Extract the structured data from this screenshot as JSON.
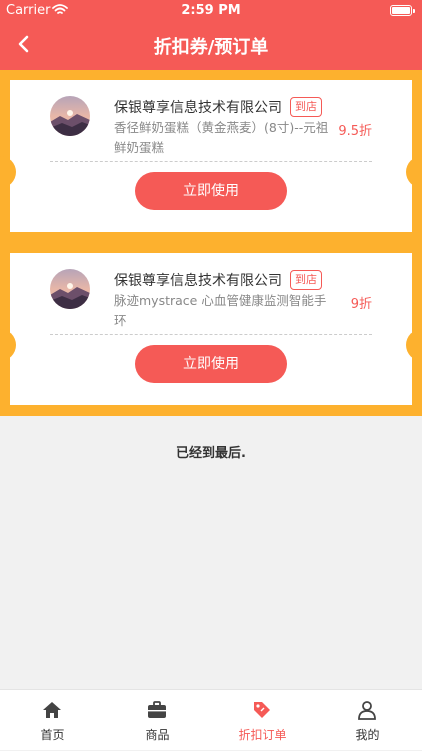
{
  "status_bar": {
    "carrier": "Carrier",
    "time": "2:59 PM"
  },
  "header": {
    "title": "折扣券/预订单"
  },
  "coupons": [
    {
      "shop": "保银尊享信息技术有限公司",
      "badge": "到店",
      "product": "香径鲜奶蛋糕（黄金燕麦）(8寸)--元祖鲜奶蛋糕",
      "discount": "9.5折",
      "button": "立即使用"
    },
    {
      "shop": "保银尊享信息技术有限公司",
      "badge": "到店",
      "product": "脉迹mystrace 心血管健康监测智能手环",
      "discount": "9折",
      "button": "立即使用"
    }
  ],
  "end_text": "已经到最后.",
  "tabbar": {
    "tabs": [
      {
        "label": "首页",
        "icon": "home-icon"
      },
      {
        "label": "商品",
        "icon": "briefcase-icon"
      },
      {
        "label": "折扣订单",
        "icon": "tag-icon"
      },
      {
        "label": "我的",
        "icon": "user-icon"
      }
    ],
    "active_index": 2
  },
  "colors": {
    "primary": "#f55a56",
    "coupon_bg": "#fdb12e",
    "page_bg": "#f1f1f1"
  }
}
